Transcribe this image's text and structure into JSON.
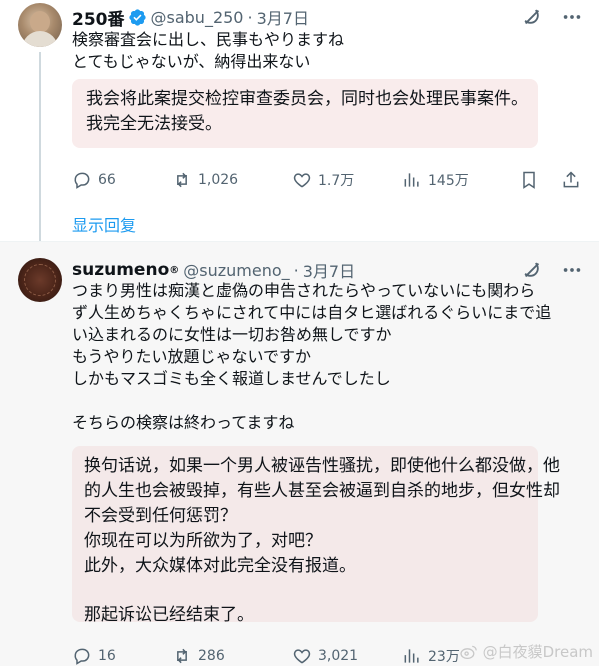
{
  "tweets": [
    {
      "author_name": "250番",
      "handle": "@sabu_250",
      "separator": "·",
      "date": "3月7日",
      "text_lines": [
        "検察審査会に出し、民事もやりますね",
        "とてもじゃないが、納得出来ない"
      ],
      "translation_lines": [
        "我会将此案提交检控审查委员会，同时也会处理民事案件。",
        "我完全无法接受。"
      ],
      "metrics": {
        "replies": "66",
        "retweets": "1,026",
        "likes": "1.7万",
        "views": "145万"
      },
      "show_replies": "显示回复"
    },
    {
      "author_name": "suzumeno",
      "name_mark": "®",
      "handle": "@suzumeno_",
      "separator": "·",
      "date": "3月7日",
      "text_lines": [
        "つまり男性は痴漢と虚偽の申告されたらやっていないにも関わら",
        "ず人生めちゃくちゃにされて中には自タヒ選ばれるぐらいにまで追",
        "い込まれるのに女性は一切お咎め無しですか",
        "もうやりたい放題じゃないですか",
        "しかもマスゴミも全く報道しませんでしたし",
        "",
        "そちらの検察は終わってますね"
      ],
      "translation_lines": [
        "换句话说，如果一个男人被诬告性骚扰，即使他什么都没做，他",
        "的人生也会被毁掉，有些人甚至会被逼到自杀的地步，但女性却",
        "不会受到任何惩罚？",
        "你现在可以为所欲为了，对吧？",
        "此外，大众媒体对此完全没有报道。",
        "",
        "那起诉讼已经结束了。"
      ],
      "metrics": {
        "replies": "16",
        "retweets": "286",
        "likes": "3,021",
        "views": "23万"
      }
    }
  ],
  "icons": {
    "verified": "verified-badge-icon",
    "grok": "grok-icon",
    "more": "more-icon",
    "reply": "reply-icon",
    "retweet": "retweet-icon",
    "like": "heart-icon",
    "views": "views-icon",
    "bookmark": "bookmark-icon",
    "share": "share-icon"
  },
  "colors": {
    "accent": "#1d9bf0",
    "muted": "#536471",
    "translation_bg": "#f9ecec"
  },
  "watermark": "@白夜貘Dream"
}
